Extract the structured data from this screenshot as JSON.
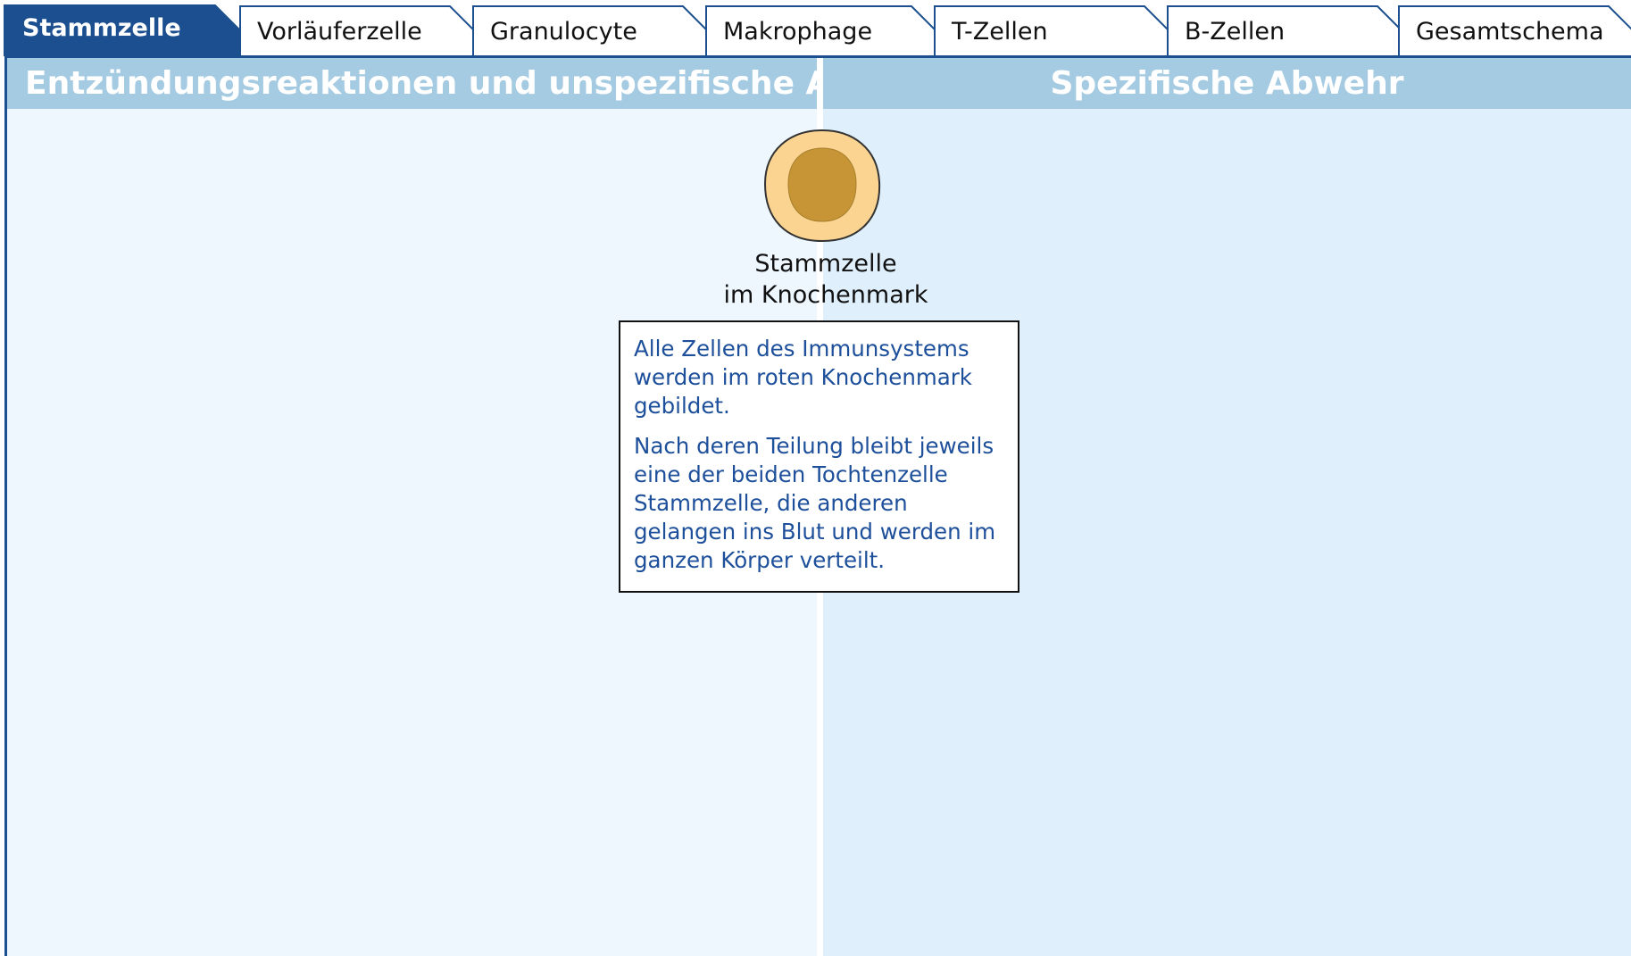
{
  "tabs": [
    {
      "label": "Stammzelle",
      "active": true
    },
    {
      "label": "Vorläuferzelle",
      "active": false
    },
    {
      "label": "Granulocyte",
      "active": false
    },
    {
      "label": "Makrophage",
      "active": false
    },
    {
      "label": "T-Zellen",
      "active": false
    },
    {
      "label": "B-Zellen",
      "active": false
    },
    {
      "label": "Gesamtschema",
      "active": false
    }
  ],
  "left_panel": {
    "title": "Entzündungsreaktionen und unspezifische Abwehr"
  },
  "right_panel": {
    "title": "Spezifische Abwehr"
  },
  "cell": {
    "caption_line1": "Stammzelle",
    "caption_line2": "im Knochenmark",
    "outer_color": "#fbd492",
    "nucleus_color": "#c79536"
  },
  "info_box": {
    "paragraph1": "Alle Zellen des Immunsystems werden im roten Knochenmark gebildet.",
    "paragraph2": "Nach deren Teilung bleibt jeweils eine der beiden Tochtenzelle Stammzelle, die anderen gelangen ins Blut und werden im ganzen Körper verteilt."
  },
  "colors": {
    "active_tab": "#1c4f8f",
    "header": "#a5cbe3",
    "left_bg": "#eef6fe",
    "right_bg": "#dff0fc",
    "info_text": "#1d4f9a"
  }
}
